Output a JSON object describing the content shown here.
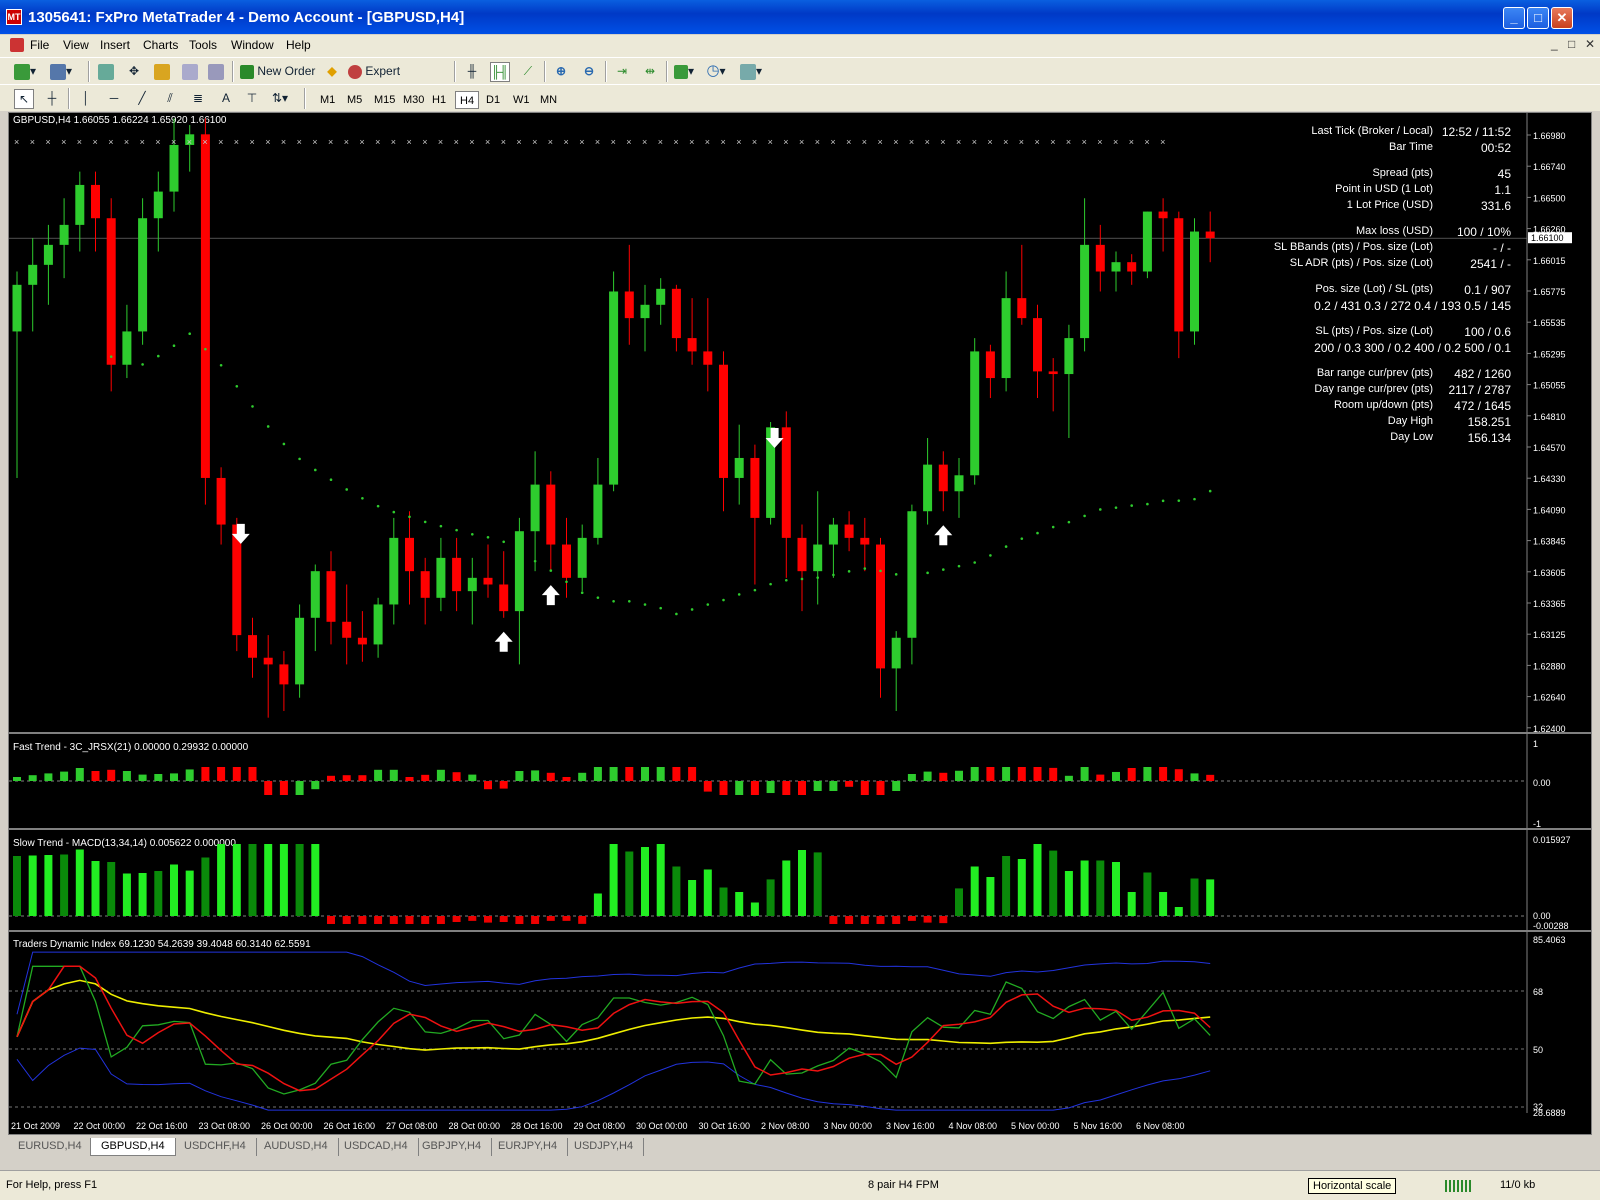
{
  "window": {
    "title": "1305641: FxPro MetaTrader 4 - Demo Account - [GBPUSD,H4]",
    "app_icon": "mt4-icon",
    "min": "_",
    "max": "□",
    "close": "✕"
  },
  "menu": [
    "File",
    "View",
    "Insert",
    "Charts",
    "Tools",
    "Window",
    "Help"
  ],
  "mdi_controls": [
    "_",
    "□",
    "✕"
  ],
  "toolbar": {
    "new_order": "New Order",
    "expert_advisors": "Expert Advisors",
    "timeframes": [
      "M1",
      "M5",
      "M15",
      "M30",
      "H1",
      "H4",
      "D1",
      "W1",
      "MN"
    ],
    "active_timeframe": "H4",
    "drawing_text_tool": "A"
  },
  "chart": {
    "header": "GBPUSD,H4  1.66055 1.66224 1.65920 1.66100",
    "price_ticks": [
      "1.66980",
      "1.66740",
      "1.66500",
      "1.66260",
      "1.66015",
      "1.65775",
      "1.65535",
      "1.65295",
      "1.65055",
      "1.64810",
      "1.64570",
      "1.64330",
      "1.64090",
      "1.63845",
      "1.63605",
      "1.63365",
      "1.63125",
      "1.62880",
      "1.62640",
      "1.62400"
    ],
    "current_price": "1.66100",
    "date_labels": [
      "21 Oct 2009",
      "22 Oct 00:00",
      "22 Oct 16:00",
      "23 Oct 08:00",
      "26 Oct 00:00",
      "26 Oct 16:00",
      "27 Oct 08:00",
      "28 Oct 00:00",
      "28 Oct 16:00",
      "29 Oct 08:00",
      "30 Oct 00:00",
      "30 Oct 16:00",
      "2 Nov 08:00",
      "3 Nov 00:00",
      "3 Nov 16:00",
      "4 Nov 08:00",
      "5 Nov 00:00",
      "5 Nov 16:00",
      "6 Nov 08:00"
    ]
  },
  "info": [
    {
      "label": "Last Tick (Broker / Local)",
      "value": "12:52 / 11:52"
    },
    {
      "label": "Bar Time",
      "value": "00:52"
    },
    {
      "label": "Spread (pts)",
      "value": "45"
    },
    {
      "label": "Point in USD (1 Lot)",
      "value": "1.1"
    },
    {
      "label": "1 Lot Price (USD)",
      "value": "331.6"
    },
    {
      "label": "Max loss (USD)",
      "value": "100 / 10%"
    },
    {
      "label": "SL BBands (pts) / Pos. size (Lot)",
      "value": "- / -"
    },
    {
      "label": "SL ADR (pts) / Pos. size (Lot)",
      "value": "2541 / -"
    },
    {
      "label": "Pos. size (Lot) / SL (pts)",
      "value": "0.1 / 907"
    },
    {
      "label": "",
      "value": "0.2 / 431   0.3 / 272   0.4 / 193   0.5 / 145"
    },
    {
      "label": "SL (pts) / Pos. size (Lot)",
      "value": "100 / 0.6"
    },
    {
      "label": "",
      "value": "200 / 0.3   300 / 0.2   400 / 0.2   500 / 0.1"
    },
    {
      "label": "Bar range cur/prev (pts)",
      "value": "482 / 1260"
    },
    {
      "label": "Day range cur/prev (pts)",
      "value": "2117 / 2787"
    },
    {
      "label": "Room up/down (pts)",
      "value": "472 / 1645"
    },
    {
      "label": "Day High",
      "value": "158.251"
    },
    {
      "label": "Day Low",
      "value": "156.134"
    }
  ],
  "panels": {
    "fast": {
      "header": "Fast Trend - 3C_JRSX(21) 0.00000 0.29932 0.00000",
      "scale_top": "1",
      "scale_mid": "0.00",
      "scale_bot": "-1"
    },
    "slow": {
      "header": "Slow Trend - MACD(13,34,14) 0.005622 0.000000",
      "scale_top": "0.015927",
      "scale_mid": "0.00",
      "scale_bot": "-0.00288"
    },
    "tdi": {
      "header": "Traders Dynamic Index 69.1230 54.2639 39.4048 60.3140 62.5591",
      "scale_top": "85.4063",
      "scale_68": "68",
      "scale_50": "50",
      "scale_32": "32",
      "scale_bot": "28.6889"
    }
  },
  "tabs": [
    "EURUSD,H4",
    "GBPUSD,H4",
    "USDCHF,H4",
    "AUDUSD,H4",
    "USDCAD,H4",
    "GBPJPY,H4",
    "EURJPY,H4",
    "USDJPY,H4"
  ],
  "active_tab": "GBPUSD,H4",
  "status": {
    "help": "For Help, press F1",
    "profile": "8 pair H4 FPM",
    "tooltip": "Horizontal scale",
    "traffic": "11/0 kb"
  },
  "colors": {
    "bull": "#2ecc2e",
    "bear": "#ff0000",
    "background": "#000000"
  },
  "chart_data": {
    "type": "candlestick",
    "symbol": "GBPUSD",
    "timeframe": "H4",
    "ylim": [
      1.624,
      1.6698
    ],
    "candles": [
      {
        "o": 1.654,
        "h": 1.6585,
        "l": 1.643,
        "c": 1.6575
      },
      {
        "o": 1.6575,
        "h": 1.661,
        "l": 1.654,
        "c": 1.659
      },
      {
        "o": 1.659,
        "h": 1.662,
        "l": 1.656,
        "c": 1.6605
      },
      {
        "o": 1.6605,
        "h": 1.664,
        "l": 1.658,
        "c": 1.662
      },
      {
        "o": 1.662,
        "h": 1.666,
        "l": 1.66,
        "c": 1.665
      },
      {
        "o": 1.665,
        "h": 1.666,
        "l": 1.66,
        "c": 1.6625
      },
      {
        "o": 1.6625,
        "h": 1.664,
        "l": 1.6495,
        "c": 1.6515
      },
      {
        "o": 1.6515,
        "h": 1.656,
        "l": 1.6505,
        "c": 1.654
      },
      {
        "o": 1.654,
        "h": 1.664,
        "l": 1.653,
        "c": 1.6625
      },
      {
        "o": 1.6625,
        "h": 1.666,
        "l": 1.66,
        "c": 1.6645
      },
      {
        "o": 1.6645,
        "h": 1.67,
        "l": 1.663,
        "c": 1.668
      },
      {
        "o": 1.668,
        "h": 1.6695,
        "l": 1.666,
        "c": 1.6688
      },
      {
        "o": 1.6688,
        "h": 1.67,
        "l": 1.641,
        "c": 1.643
      },
      {
        "o": 1.643,
        "h": 1.6438,
        "l": 1.638,
        "c": 1.6395
      },
      {
        "o": 1.6395,
        "h": 1.64,
        "l": 1.63,
        "c": 1.6312
      },
      {
        "o": 1.6312,
        "h": 1.6325,
        "l": 1.628,
        "c": 1.6295
      },
      {
        "o": 1.6295,
        "h": 1.6312,
        "l": 1.625,
        "c": 1.629
      },
      {
        "o": 1.629,
        "h": 1.63,
        "l": 1.6255,
        "c": 1.6275
      },
      {
        "o": 1.6275,
        "h": 1.6335,
        "l": 1.6265,
        "c": 1.6325
      },
      {
        "o": 1.6325,
        "h": 1.6365,
        "l": 1.63,
        "c": 1.636
      },
      {
        "o": 1.636,
        "h": 1.6375,
        "l": 1.6305,
        "c": 1.6322
      },
      {
        "o": 1.6322,
        "h": 1.635,
        "l": 1.629,
        "c": 1.631
      },
      {
        "o": 1.631,
        "h": 1.633,
        "l": 1.6292,
        "c": 1.6305
      },
      {
        "o": 1.6305,
        "h": 1.634,
        "l": 1.6295,
        "c": 1.6335
      },
      {
        "o": 1.6335,
        "h": 1.64,
        "l": 1.632,
        "c": 1.6385
      },
      {
        "o": 1.6385,
        "h": 1.6405,
        "l": 1.6335,
        "c": 1.636
      },
      {
        "o": 1.636,
        "h": 1.637,
        "l": 1.632,
        "c": 1.634
      },
      {
        "o": 1.634,
        "h": 1.6385,
        "l": 1.633,
        "c": 1.637
      },
      {
        "o": 1.637,
        "h": 1.6385,
        "l": 1.633,
        "c": 1.6345
      },
      {
        "o": 1.6345,
        "h": 1.637,
        "l": 1.632,
        "c": 1.6355
      },
      {
        "o": 1.6355,
        "h": 1.638,
        "l": 1.634,
        "c": 1.635
      },
      {
        "o": 1.635,
        "h": 1.6375,
        "l": 1.6325,
        "c": 1.633
      },
      {
        "o": 1.633,
        "h": 1.64,
        "l": 1.629,
        "c": 1.639
      },
      {
        "o": 1.639,
        "h": 1.645,
        "l": 1.636,
        "c": 1.6425
      },
      {
        "o": 1.6425,
        "h": 1.6435,
        "l": 1.636,
        "c": 1.638
      },
      {
        "o": 1.638,
        "h": 1.64,
        "l": 1.634,
        "c": 1.6355
      },
      {
        "o": 1.6355,
        "h": 1.6395,
        "l": 1.6345,
        "c": 1.6385
      },
      {
        "o": 1.6385,
        "h": 1.6445,
        "l": 1.638,
        "c": 1.6425
      },
      {
        "o": 1.6425,
        "h": 1.6585,
        "l": 1.642,
        "c": 1.657
      },
      {
        "o": 1.657,
        "h": 1.6605,
        "l": 1.653,
        "c": 1.655
      },
      {
        "o": 1.655,
        "h": 1.6575,
        "l": 1.6525,
        "c": 1.656
      },
      {
        "o": 1.656,
        "h": 1.658,
        "l": 1.6545,
        "c": 1.6572
      },
      {
        "o": 1.6572,
        "h": 1.6575,
        "l": 1.6525,
        "c": 1.6535
      },
      {
        "o": 1.6535,
        "h": 1.6565,
        "l": 1.6515,
        "c": 1.6525
      },
      {
        "o": 1.6525,
        "h": 1.6565,
        "l": 1.6495,
        "c": 1.6515
      },
      {
        "o": 1.6515,
        "h": 1.6525,
        "l": 1.6405,
        "c": 1.643
      },
      {
        "o": 1.643,
        "h": 1.647,
        "l": 1.641,
        "c": 1.6445
      },
      {
        "o": 1.6445,
        "h": 1.6455,
        "l": 1.635,
        "c": 1.64
      },
      {
        "o": 1.64,
        "h": 1.6472,
        "l": 1.6395,
        "c": 1.6468
      },
      {
        "o": 1.6468,
        "h": 1.648,
        "l": 1.6355,
        "c": 1.6385
      },
      {
        "o": 1.6385,
        "h": 1.6395,
        "l": 1.633,
        "c": 1.636
      },
      {
        "o": 1.636,
        "h": 1.642,
        "l": 1.6335,
        "c": 1.638
      },
      {
        "o": 1.638,
        "h": 1.64,
        "l": 1.6355,
        "c": 1.6395
      },
      {
        "o": 1.6395,
        "h": 1.6405,
        "l": 1.6375,
        "c": 1.6385
      },
      {
        "o": 1.6385,
        "h": 1.64,
        "l": 1.636,
        "c": 1.638
      },
      {
        "o": 1.638,
        "h": 1.6385,
        "l": 1.6265,
        "c": 1.6287
      },
      {
        "o": 1.6287,
        "h": 1.6315,
        "l": 1.6255,
        "c": 1.631
      },
      {
        "o": 1.631,
        "h": 1.641,
        "l": 1.629,
        "c": 1.6405
      },
      {
        "o": 1.6405,
        "h": 1.646,
        "l": 1.6395,
        "c": 1.644
      },
      {
        "o": 1.644,
        "h": 1.645,
        "l": 1.6405,
        "c": 1.642
      },
      {
        "o": 1.642,
        "h": 1.6445,
        "l": 1.64,
        "c": 1.6432
      },
      {
        "o": 1.6432,
        "h": 1.6535,
        "l": 1.6425,
        "c": 1.6525
      },
      {
        "o": 1.6525,
        "h": 1.653,
        "l": 1.649,
        "c": 1.6505
      },
      {
        "o": 1.6505,
        "h": 1.6585,
        "l": 1.6495,
        "c": 1.6565
      },
      {
        "o": 1.6565,
        "h": 1.6605,
        "l": 1.6545,
        "c": 1.655
      },
      {
        "o": 1.655,
        "h": 1.656,
        "l": 1.649,
        "c": 1.651
      },
      {
        "o": 1.651,
        "h": 1.652,
        "l": 1.648,
        "c": 1.6508
      },
      {
        "o": 1.6508,
        "h": 1.6545,
        "l": 1.646,
        "c": 1.6535
      },
      {
        "o": 1.6535,
        "h": 1.664,
        "l": 1.6525,
        "c": 1.6605
      },
      {
        "o": 1.6605,
        "h": 1.662,
        "l": 1.657,
        "c": 1.6585
      },
      {
        "o": 1.6585,
        "h": 1.66,
        "l": 1.657,
        "c": 1.6592
      },
      {
        "o": 1.6592,
        "h": 1.6598,
        "l": 1.6575,
        "c": 1.6585
      },
      {
        "o": 1.6585,
        "h": 1.663,
        "l": 1.658,
        "c": 1.663
      },
      {
        "o": 1.663,
        "h": 1.664,
        "l": 1.66,
        "c": 1.6625
      },
      {
        "o": 1.6625,
        "h": 1.663,
        "l": 1.652,
        "c": 1.654
      },
      {
        "o": 1.654,
        "h": 1.6625,
        "l": 1.653,
        "c": 1.6615
      },
      {
        "o": 1.6615,
        "h": 1.663,
        "l": 1.6592,
        "c": 1.661
      }
    ],
    "arrows_up": [
      31,
      34,
      59
    ],
    "arrows_down": [
      14,
      48
    ]
  }
}
